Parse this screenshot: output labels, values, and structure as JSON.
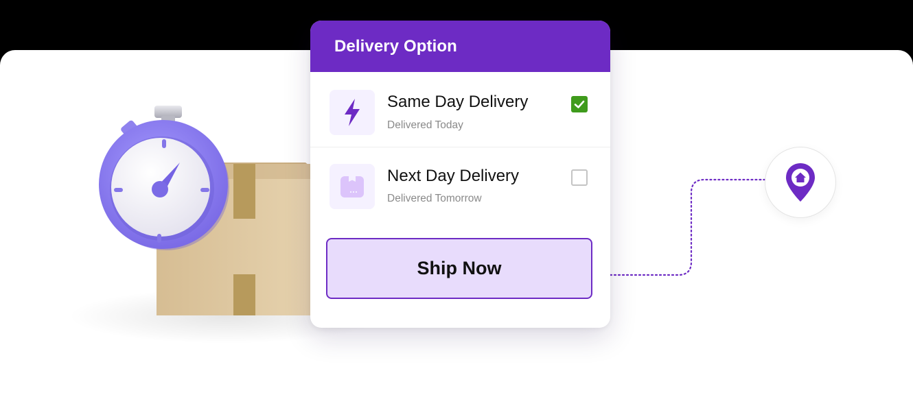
{
  "card": {
    "title": "Delivery Option",
    "options": [
      {
        "title": "Same Day Delivery",
        "subtitle": "Delivered Today",
        "checked": true,
        "icon": "lightning-icon"
      },
      {
        "title": "Next Day Delivery",
        "subtitle": "Delivered Tomorrow",
        "checked": false,
        "icon": "package-icon"
      }
    ],
    "button_label": "Ship Now"
  },
  "destination": {
    "icon": "home-location-pin-icon"
  },
  "colors": {
    "brand": "#6d2bc4",
    "button_bg": "#e8dcfc",
    "check_green": "#3f9b1c",
    "timer_purple": "#8c7cf0",
    "box_cardboard": "#d9bf94"
  }
}
